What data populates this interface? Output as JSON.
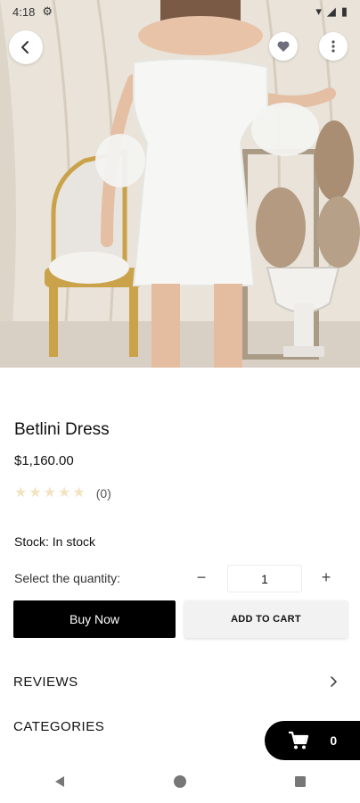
{
  "status_bar": {
    "time": "4:18"
  },
  "product": {
    "title": "Betlini Dress",
    "price": "$1,160.00",
    "rating_stars": 0,
    "rating_count": "(0)",
    "stock": "Stock: In stock"
  },
  "quantity": {
    "label": "Select the quantity:",
    "value": "1",
    "minus": "−",
    "plus": "+"
  },
  "actions": {
    "buy_now": "Buy Now",
    "add_to_cart": "ADD TO CART"
  },
  "sections": {
    "reviews": "REVIEWS",
    "categories": "CATEGORIES"
  },
  "cart": {
    "count": "0"
  },
  "colors": {
    "primary": "#000000",
    "star_empty": "#f3e3c1",
    "secondary_button": "#f2f2f2"
  },
  "icons": [
    "back-arrow-icon",
    "heart-icon",
    "more-vert-icon",
    "cart-icon",
    "chevron-right-icon",
    "nav-back-icon",
    "nav-home-icon",
    "nav-recents-icon"
  ]
}
